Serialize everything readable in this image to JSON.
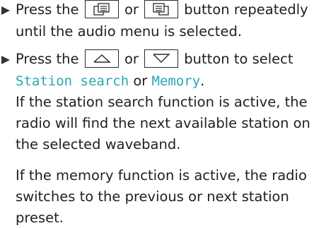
{
  "step1": {
    "text_before": "Press the",
    "text_or": "or",
    "text_after": "button repeatedly",
    "line2": "until the audio menu is selected.",
    "button_left_icon": "menu-back-icon",
    "button_right_icon": "menu-forward-icon"
  },
  "step2": {
    "text_before": "Press the",
    "text_or": "or",
    "text_after": "button to select",
    "button_up_icon": "triangle-up-icon",
    "button_down_icon": "triangle-down-icon",
    "option_station_search": "Station search",
    "option_memory": "Memory",
    "word_or": "or",
    "period": ".",
    "para1": [
      "If the station search function is active, the",
      "radio will find the next available station on",
      "the selected waveband."
    ],
    "para2": [
      "If the memory function is active, the radio",
      "switches to the previous or next station",
      "preset."
    ]
  },
  "colors": {
    "text": "#1f1f1f",
    "highlight": "#2aa8b2",
    "bullet": "#333333"
  }
}
